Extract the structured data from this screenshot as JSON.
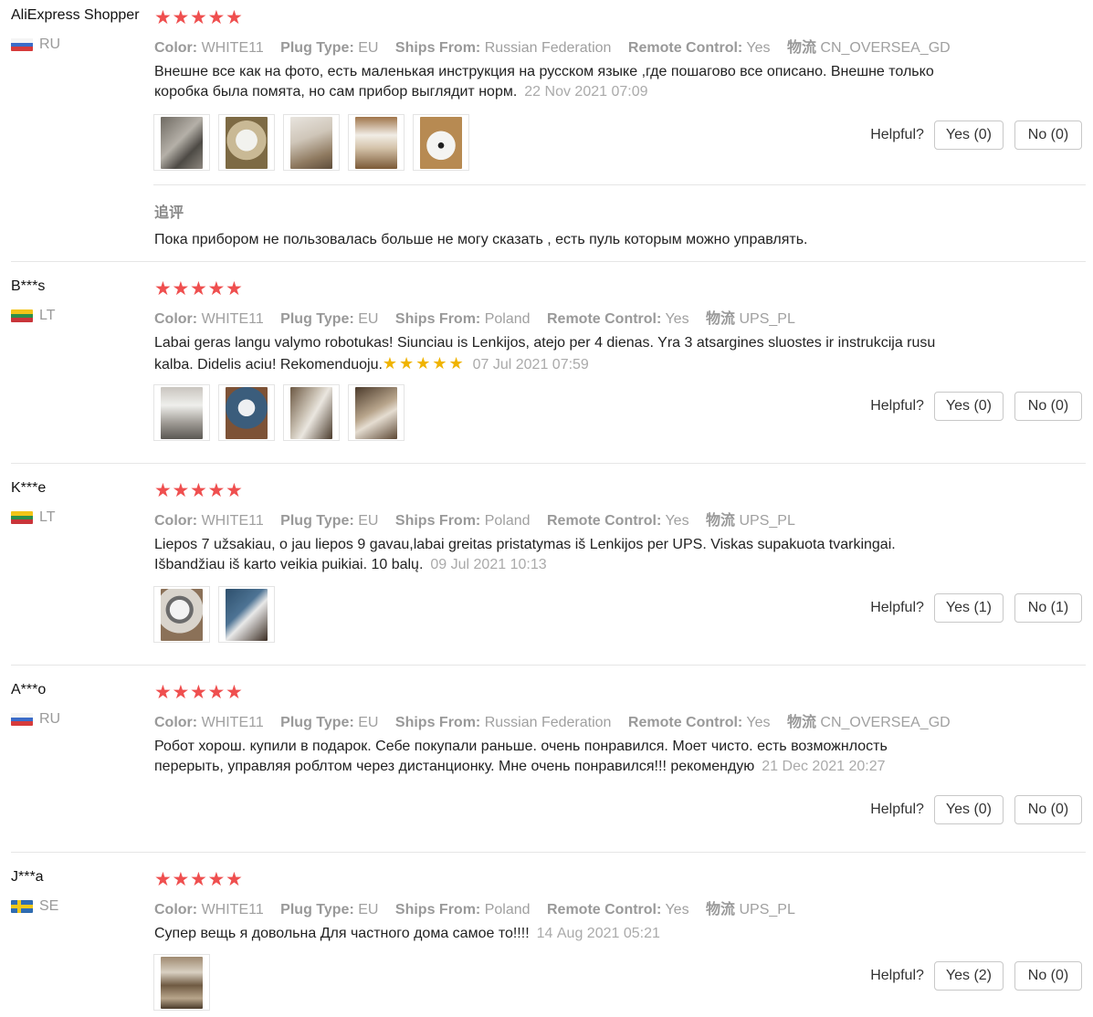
{
  "labels": {
    "color_key": "Color:",
    "plug_key": "Plug Type:",
    "ships_key": "Ships From:",
    "remote_key": "Remote Control:",
    "logistics_key": "物流",
    "helpful": "Helpful?",
    "additional_review": "追评",
    "star_glyph": "★"
  },
  "colors": {
    "star": "#ef4f4f",
    "inline_star": "#f0b400",
    "muted_text": "#999999"
  },
  "reviews": [
    {
      "user": "AliExpress Shopper",
      "country": "RU",
      "flag": "ru-flag-icon",
      "rating": 5,
      "color": "WHITE11",
      "plug": "EU",
      "ships_from": "Russian Federation",
      "remote": "Yes",
      "logistics": "CN_OVERSEA_GD",
      "text": "Внешне все как на фото, есть маленькая инструкция на русском языке ,где пошагово все описано. Внешне только коробка была помята, но сам прибор выглядит норм.",
      "date": "22 Nov 2021 07:09",
      "photos": 5,
      "yes": "Yes (0)",
      "no": "No (0)",
      "additional": "Пока прибором не пользовалась больше не могу сказать , есть пуль которым можно управлять."
    },
    {
      "user": "B***s",
      "country": "LT",
      "flag": "lt-flag-icon",
      "rating": 5,
      "color": "WHITE11",
      "plug": "EU",
      "ships_from": "Poland",
      "remote": "Yes",
      "logistics": "UPS_PL",
      "text": "Labai geras langu valymo robotukas! Siunciau is Lenkijos, atejo per 4 dienas. Yra 3 atsargines sluostes ir instrukcija rusu kalba. Didelis aciu! Rekomenduoju.",
      "inline_stars": "★★★★★",
      "date": "07 Jul 2021 07:59",
      "photos": 4,
      "yes": "Yes (0)",
      "no": "No (0)"
    },
    {
      "user": "K***e",
      "country": "LT",
      "flag": "lt-flag-icon",
      "rating": 5,
      "color": "WHITE11",
      "plug": "EU",
      "ships_from": "Poland",
      "remote": "Yes",
      "logistics": "UPS_PL",
      "text": "Liepos 7 užsakiau, o jau liepos 9 gavau,labai greitas pristatymas iš Lenkijos per UPS. Viskas supakuota tvarkingai. Išbandžiau iš karto veikia puikiai. 10 balų.",
      "date": "09 Jul 2021 10:13",
      "photos": 2,
      "yes": "Yes (1)",
      "no": "No (1)"
    },
    {
      "user": "A***o",
      "country": "RU",
      "flag": "ru-flag-icon",
      "rating": 5,
      "color": "WHITE11",
      "plug": "EU",
      "ships_from": "Russian Federation",
      "remote": "Yes",
      "logistics": "CN_OVERSEA_GD",
      "text": "Робот хорош. купили в подарок. Себе покупали раньше. очень понравился. Моет чисто. есть возможнлость перерыть, управляя роблтом через дистанционку. Мне очень понравился!!! рекомендую",
      "date": "21 Dec 2021 20:27",
      "photos": 0,
      "yes": "Yes (0)",
      "no": "No (0)"
    },
    {
      "user": "J***a",
      "country": "SE",
      "flag": "se-flag-icon",
      "rating": 5,
      "color": "WHITE11",
      "plug": "EU",
      "ships_from": "Poland",
      "remote": "Yes",
      "logistics": "UPS_PL",
      "text": "Супер вещь я довольна Для частного дома самое то!!!!",
      "date": "14 Aug 2021 05:21",
      "photos": 1,
      "yes": "Yes (2)",
      "no": "No (0)"
    }
  ]
}
